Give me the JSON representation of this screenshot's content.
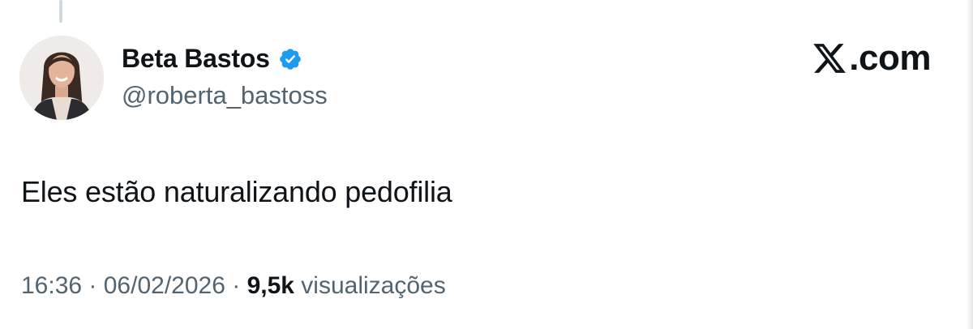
{
  "author": {
    "display_name": "Beta Bastos",
    "handle": "@roberta_bastoss",
    "verified": true
  },
  "brand": {
    "logo_icon": "x-logo-icon",
    "domain": ".com"
  },
  "tweet": {
    "text": "Eles estão naturalizando pedofilia"
  },
  "meta": {
    "time": "16:36",
    "separator": " · ",
    "date": "06/02/2026",
    "views_count": "9,5k",
    "views_label": " visualizações"
  },
  "colors": {
    "text_primary": "#0f1419",
    "text_secondary": "#536471",
    "verified_blue": "#1d9bf0",
    "thread_line": "#cfd9de"
  }
}
